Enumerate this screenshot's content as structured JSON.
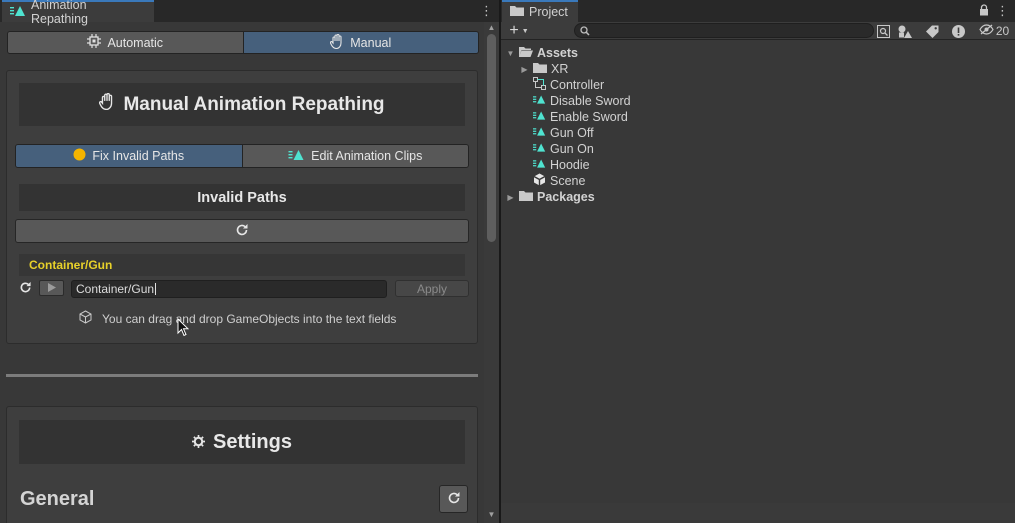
{
  "left_window": {
    "tab_title": "Animation Repathing",
    "mode_toggle": {
      "automatic": "Automatic",
      "manual": "Manual",
      "selected": "Manual"
    },
    "manual_panel": {
      "title": "Manual Animation Repathing",
      "subtabs": {
        "fix_invalid": "Fix Invalid Paths",
        "edit_clips": "Edit Animation Clips",
        "selected": "Fix Invalid Paths"
      },
      "invalid_paths_title": "Invalid Paths",
      "path_entry": {
        "label": "Container/Gun",
        "input_value": "Container/Gun",
        "apply_label": "Apply"
      },
      "hint": "You can drag and drop GameObjects into the text fields"
    },
    "settings_panel": {
      "title": "Settings",
      "general_title": "General"
    }
  },
  "right_window": {
    "tab_title": "Project",
    "hidden_count": "20",
    "search": {
      "value": "",
      "placeholder": ""
    },
    "tree": {
      "assets_label": "Assets",
      "assets_children": [
        {
          "label": "XR",
          "icon": "folder-icon"
        },
        {
          "label": "Controller",
          "icon": "animator-controller-icon"
        },
        {
          "label": "Disable Sword",
          "icon": "animation-clip-icon"
        },
        {
          "label": "Enable Sword",
          "icon": "animation-clip-icon"
        },
        {
          "label": "Gun Off",
          "icon": "animation-clip-icon"
        },
        {
          "label": "Gun On",
          "icon": "animation-clip-icon"
        },
        {
          "label": "Hoodie",
          "icon": "animation-clip-icon"
        },
        {
          "label": "Scene",
          "icon": "unity-scene-icon"
        }
      ],
      "packages_label": "Packages"
    }
  },
  "colors": {
    "accent_blue": "#46607c",
    "warning_yellow": "#e8d12a",
    "status_dot": "#f4b400",
    "clip_teal": "#4fe3d0"
  }
}
